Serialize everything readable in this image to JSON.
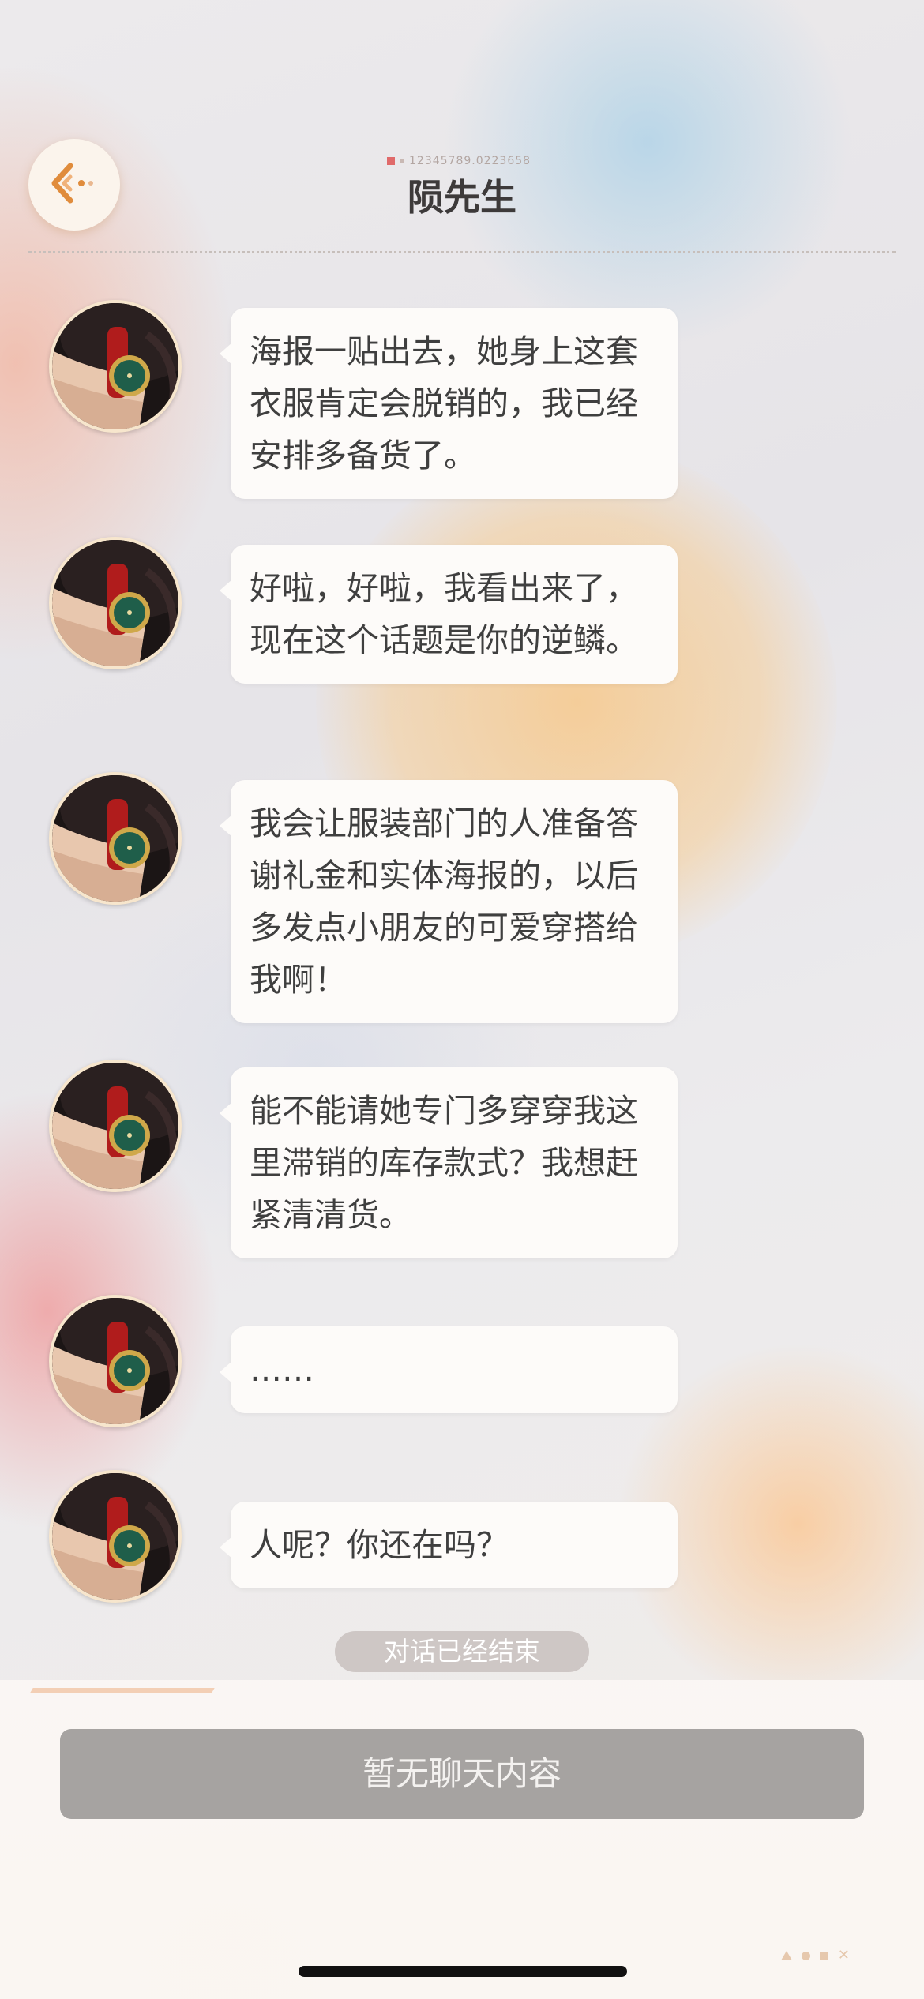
{
  "header": {
    "subtitle_code": "12345789.0223658",
    "title": "陨先生"
  },
  "messages": [
    {
      "text": "海报一贴出去，她身上这套衣服肯定会脱销的，我已经安排多备货了。"
    },
    {
      "text": "好啦，好啦，我看出来了，现在这个话题是你的逆鳞。"
    },
    {
      "text": "我会让服装部门的人准备答谢礼金和实体海报的，以后多发点小朋友的可爱穿搭给我啊！"
    },
    {
      "text": "能不能请她专门多穿穿我这里滞销的库存款式？我想赶紧清清货。"
    },
    {
      "text": "……"
    },
    {
      "text": "人呢？你还在吗？"
    }
  ],
  "status": {
    "ended_label": "对话已经结束"
  },
  "footer": {
    "empty_button_label": "暂无聊天内容"
  },
  "colors": {
    "accent": "#e08c3c",
    "bubble": "#fdfbf9",
    "text": "#3f3f3f",
    "button_gray": "#a6a3a1"
  }
}
